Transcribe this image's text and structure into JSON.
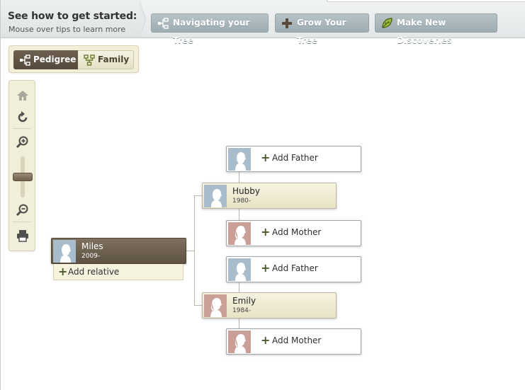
{
  "tips": {
    "title": "See how to get started:",
    "subtitle": "Mouse over tips to learn more",
    "buttons": [
      {
        "label": "Navigating your Tree",
        "icon": "pedigree-icon"
      },
      {
        "label": "Grow Your Tree",
        "icon": "plus-icon"
      },
      {
        "label": "Make New Discoveries",
        "icon": "leaf-icon"
      }
    ]
  },
  "view_toggle": {
    "pedigree_label": "Pedigree",
    "family_label": "Family",
    "selected": "Pedigree"
  },
  "tools": [
    "home-icon",
    "refresh-icon",
    "zoom-in-icon",
    "zoom-slider",
    "zoom-out-icon",
    "print-icon"
  ],
  "tree": {
    "focus": {
      "name": "Miles",
      "dates": "2009-",
      "add_relative": "Add relative"
    },
    "father": {
      "name": "Hubby",
      "dates": "1980-"
    },
    "mother": {
      "name": "Emily",
      "dates": "1984-"
    },
    "father_father": {
      "label": "Add Father"
    },
    "father_mother": {
      "label": "Add Mother"
    },
    "mother_father": {
      "label": "Add Father"
    },
    "mother_mother": {
      "label": "Add Mother"
    }
  },
  "colors": {
    "tip_button": "#a8b6ba",
    "focus_card": "#6b5e4d",
    "filled_card": "#eee9cd",
    "male_silhouette_bg": "#a9bccb",
    "female_silhouette_bg": "#c99f97",
    "panel_bg": "#f1efd9"
  }
}
